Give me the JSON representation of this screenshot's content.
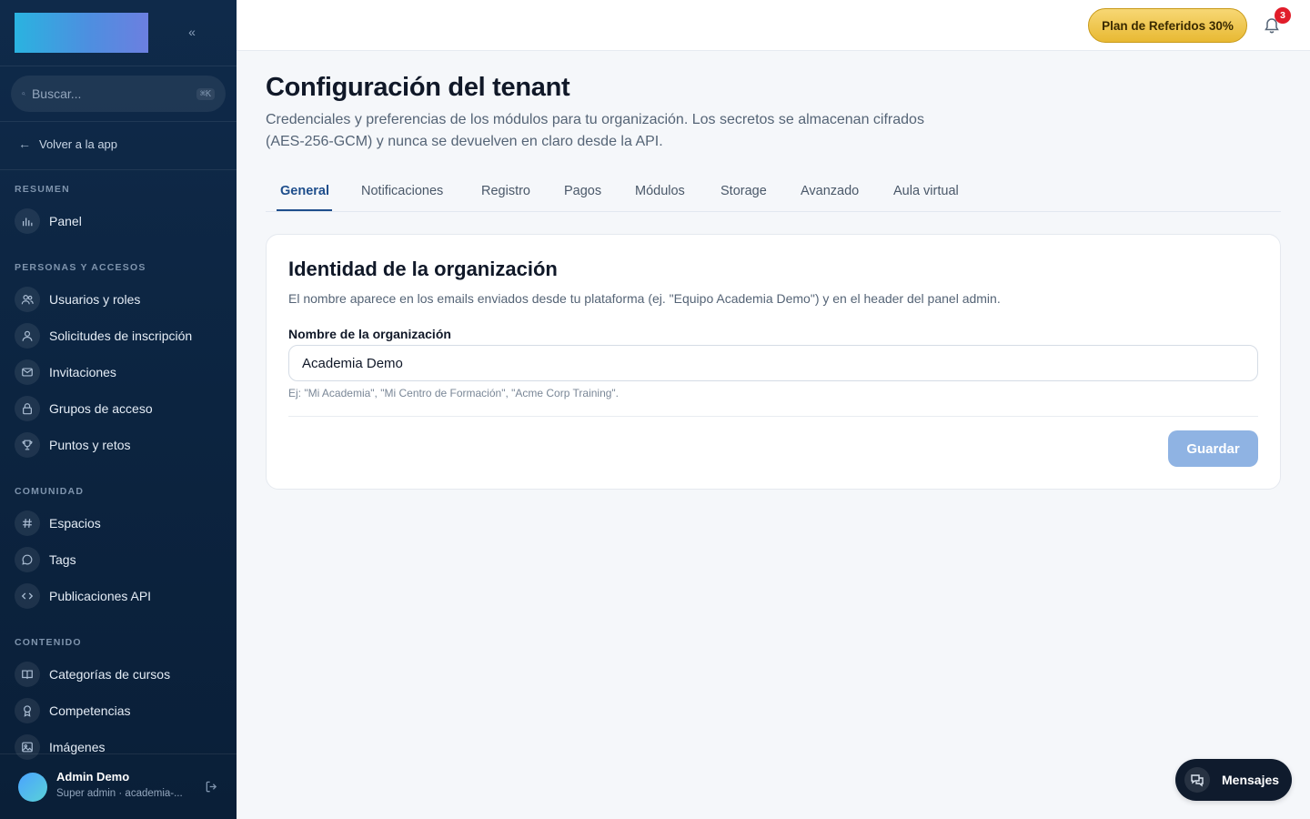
{
  "sidebar": {
    "search_placeholder": "Buscar...",
    "search_shortcut": "⌘K",
    "back_label": "Volver a la app",
    "sections": [
      {
        "label": "RESUMEN",
        "items": [
          {
            "label": "Panel",
            "icon": "chart-bars-icon"
          }
        ]
      },
      {
        "label": "PERSONAS Y ACCESOS",
        "items": [
          {
            "label": "Usuarios y roles",
            "icon": "users-icon"
          },
          {
            "label": "Solicitudes de inscripción",
            "icon": "user-icon"
          },
          {
            "label": "Invitaciones",
            "icon": "mail-icon"
          },
          {
            "label": "Grupos de acceso",
            "icon": "lock-icon"
          },
          {
            "label": "Puntos y retos",
            "icon": "trophy-icon"
          }
        ]
      },
      {
        "label": "COMUNIDAD",
        "items": [
          {
            "label": "Espacios",
            "icon": "hash-icon"
          },
          {
            "label": "Tags",
            "icon": "chat-bubble-icon"
          },
          {
            "label": "Publicaciones API",
            "icon": "code-icon"
          }
        ]
      },
      {
        "label": "CONTENIDO",
        "items": [
          {
            "label": "Categorías de cursos",
            "icon": "book-icon"
          },
          {
            "label": "Competencias",
            "icon": "award-icon"
          },
          {
            "label": "Imágenes",
            "icon": "image-icon"
          }
        ]
      }
    ],
    "user": {
      "name": "Admin Demo",
      "role": "Super admin · academia-..."
    }
  },
  "topbar": {
    "referral_label": "Plan de Referidos 30%",
    "notification_count": "3"
  },
  "main": {
    "title": "Configuración del tenant",
    "description": "Credenciales y preferencias de los módulos para tu organización. Los secretos se almacenan cifrados (AES-256-GCM) y nunca se devuelven en claro desde la API.",
    "tabs": [
      {
        "label": "General",
        "active": true
      },
      {
        "label": "Notificaciones"
      },
      {
        "label": "Registro"
      },
      {
        "label": "Pagos"
      },
      {
        "label": "Módulos"
      },
      {
        "label": "Storage"
      },
      {
        "label": "Avanzado"
      },
      {
        "label": "Aula virtual"
      }
    ],
    "card": {
      "title": "Identidad de la organización",
      "description": "El nombre aparece en los emails enviados desde tu plataforma (ej. \"Equipo Academia Demo\") y en el header del panel admin.",
      "field_label": "Nombre de la organización",
      "field_value": "Academia Demo",
      "field_hint": "Ej: \"Mi Academia\", \"Mi Centro de Formación\", \"Acme Corp Training\".",
      "save_label": "Guardar"
    }
  },
  "messages_label": "Mensajes",
  "colors": {
    "sidebar_bg": "#0f2a4a",
    "accent": "#1e4e8c",
    "save_button": "#8fb3e3",
    "badge": "#e11d2a",
    "referral_gold": "#e8b933"
  }
}
